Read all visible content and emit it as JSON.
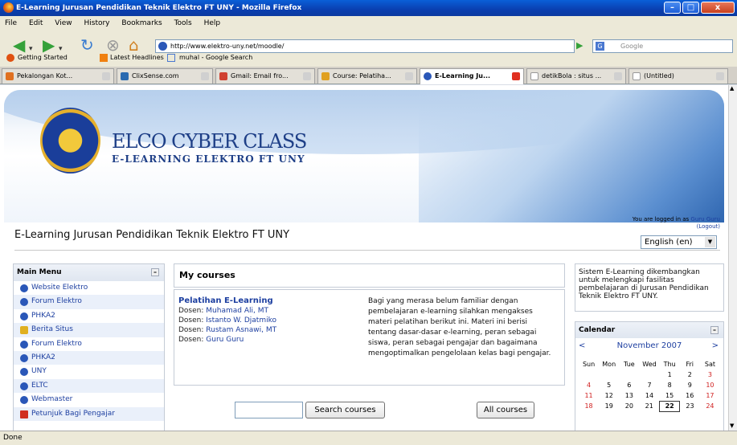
{
  "window": {
    "title": "E-Learning Jurusan Pendidikan Teknik Elektro FT UNY - Mozilla Firefox"
  },
  "menu": [
    "File",
    "Edit",
    "View",
    "History",
    "Bookmarks",
    "Tools",
    "Help"
  ],
  "nav": {
    "url": "http://www.elektro-uny.net/moodle/",
    "search_placeholder": "Google"
  },
  "bookmarks": [
    "Getting Started",
    "Latest Headlines",
    "muhal - Google Search"
  ],
  "tabs": [
    {
      "label": "Pekalongan Kot...",
      "color": "#e07020"
    },
    {
      "label": "ClixSense.com",
      "color": "#2a6ab0"
    },
    {
      "label": "Gmail: Email fro...",
      "color": "#d04030"
    },
    {
      "label": "Course: Pelatiha...",
      "color": "#e0a020"
    },
    {
      "label": "E-Learning Ju...",
      "color": "#2a57b8"
    },
    {
      "label": "detikBola : situs ...",
      "color": "#ffffff"
    },
    {
      "label": "(Untitled)",
      "color": "#ffffff"
    }
  ],
  "page": {
    "brand_line1": "ELCO CYBER CLASS",
    "brand_line2": "E-LEARNING ELEKTRO FT UNY",
    "login_prefix": "You are logged in as",
    "login_user": "Guru Guru",
    "logout": "(Logout)",
    "site_title": "E-Learning Jurusan Pendidikan Teknik Elektro FT UNY",
    "language": "English (en)"
  },
  "main_menu": {
    "title": "Main Menu",
    "items": [
      "Website Elektro",
      "Forum Elektro",
      "PHKA2",
      "Berita Situs",
      "Forum Elektro",
      "PHKA2",
      "UNY",
      "ELTC",
      "Webmaster",
      "Petunjuk Bagi Pengajar"
    ]
  },
  "courses": {
    "heading": "My courses",
    "course_name": "Pelatihan E-Learning",
    "dosen_label": "Dosen:",
    "teachers": [
      "Muhamad Ali, MT",
      "Istanto W. Djatmiko",
      "Rustam Asnawi, MT",
      "Guru Guru"
    ],
    "summary": "Bagi yang merasa belum familiar dengan pembelajaran e-learning silahkan mengakses materi pelatihan berikut ini. Materi ini berisi tentang dasar-dasar e-learning, peran sebagai siswa, peran sebagai pengajar dan bagaimana mengoptimalkan pengelolaan kelas bagi pengajar.",
    "search_button": "Search courses",
    "all_button": "All courses"
  },
  "sidebar": {
    "description": "Sistem E-Learning dikembangkan untuk melengkapi fasilitas pembelajaran di Jurusan Pendidikan Teknik Elektro FT UNY."
  },
  "calendar": {
    "title": "Calendar",
    "prev": "<",
    "month": "November 2007",
    "next": ">",
    "weekdays": [
      "Sun",
      "Mon",
      "Tue",
      "Wed",
      "Thu",
      "Fri",
      "Sat"
    ],
    "weeks": [
      [
        "",
        "",
        "",
        "",
        "1",
        "2",
        "3"
      ],
      [
        "4",
        "5",
        "6",
        "7",
        "8",
        "9",
        "10"
      ],
      [
        "11",
        "12",
        "13",
        "14",
        "15",
        "16",
        "17"
      ],
      [
        "18",
        "19",
        "20",
        "21",
        "22",
        "23",
        "24"
      ]
    ],
    "today": "22",
    "weekend_color": "#d02020"
  },
  "status": "Done"
}
